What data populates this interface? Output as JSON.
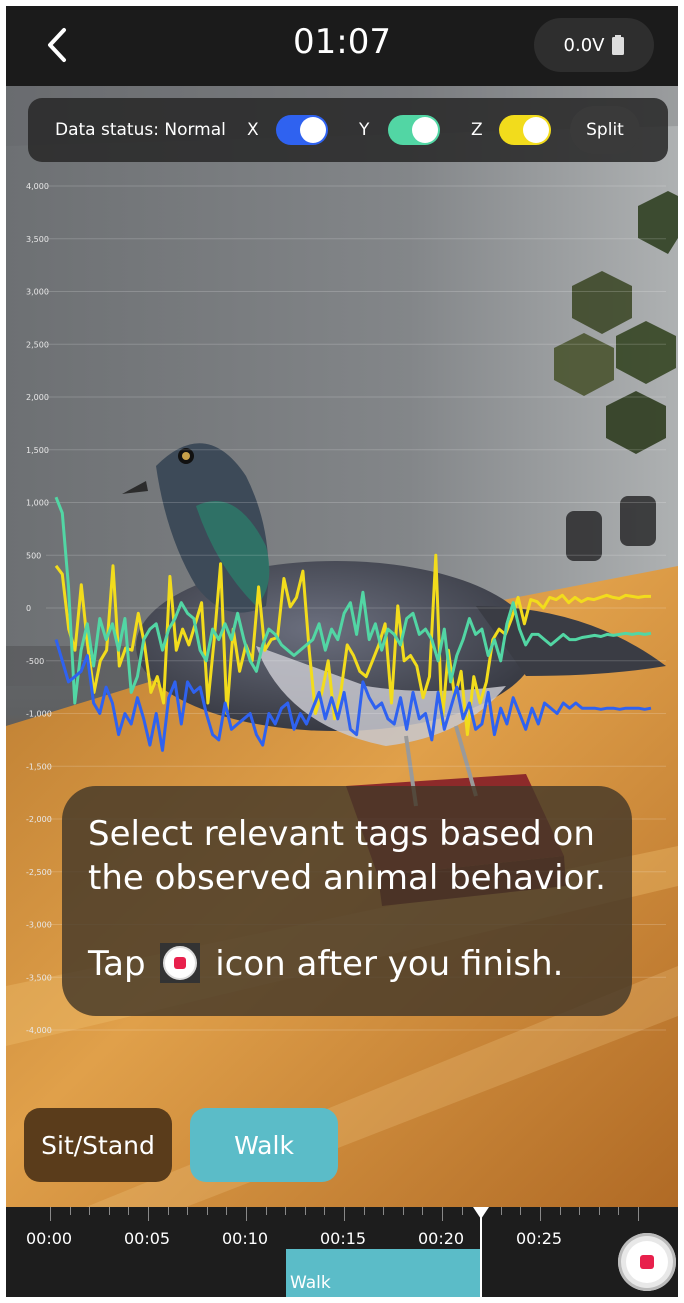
{
  "header": {
    "time": "01:07",
    "battery": "0.0V"
  },
  "status_bar": {
    "label": "Data status: Normal",
    "x_label": "X",
    "y_label": "Y",
    "z_label": "Z",
    "split_label": "Split",
    "colors": {
      "x": "#2f62f0",
      "y": "#52d6a4",
      "z": "#f2dc1c"
    }
  },
  "chart_data": {
    "type": "line",
    "y_ticks": [
      "4,000",
      "3,500",
      "3,000",
      "2,500",
      "2,000",
      "1,500",
      "1,000",
      "500",
      "0",
      "-500",
      "-1,000",
      "-1,500",
      "-2,000",
      "-2,500",
      "-3,000",
      "-3,500",
      "-4,000"
    ],
    "ylim": [
      -4000,
      4000
    ],
    "grid": true,
    "series": [
      {
        "color": "#f2dc1c",
        "values": [
          400,
          320,
          -200,
          -400,
          220,
          -350,
          -800,
          -500,
          -400,
          400,
          -550,
          -380,
          -400,
          -50,
          -350,
          -800,
          -650,
          -900,
          300,
          -400,
          -200,
          -350,
          -150,
          50,
          -900,
          -300,
          420,
          -1000,
          -200,
          -600,
          -350,
          -500,
          200,
          -400,
          -300,
          -280,
          280,
          10,
          100,
          350,
          -400,
          -1000,
          -800,
          -500,
          -1050,
          -800,
          -350,
          -450,
          -600,
          -650,
          -500,
          -350,
          -150,
          -900,
          20,
          -500,
          -450,
          -550,
          -850,
          -650,
          500,
          -1100,
          -400,
          -850,
          -600,
          -1200,
          -650,
          -900,
          -700,
          -300,
          -200,
          -250,
          -100,
          100,
          -150,
          80,
          60,
          0,
          100,
          80,
          120,
          50,
          100,
          60,
          90,
          80,
          100,
          120,
          100,
          90,
          120,
          110,
          100,
          110,
          110
        ]
      },
      {
        "color": "#52d6a4",
        "values": [
          1050,
          900,
          200,
          -900,
          -400,
          -150,
          -550,
          -100,
          -300,
          -150,
          -400,
          -100,
          -800,
          -650,
          -300,
          -200,
          -150,
          -400,
          -200,
          -100,
          50,
          -50,
          -100,
          -400,
          -500,
          -200,
          -300,
          -150,
          -300,
          -50,
          -300,
          -500,
          -600,
          -350,
          -200,
          -250,
          -350,
          -400,
          -450,
          -400,
          -350,
          -300,
          -150,
          -400,
          -200,
          -300,
          -50,
          50,
          -250,
          150,
          -300,
          -150,
          -400,
          -200,
          -250,
          -350,
          -100,
          -50,
          -250,
          -200,
          -300,
          -500,
          -200,
          -700,
          -450,
          -300,
          -100,
          -250,
          -200,
          -450,
          -300,
          -500,
          -150,
          50,
          -200,
          -350,
          -250,
          -250,
          -300,
          -350,
          -300,
          -250,
          -300,
          -300,
          -280,
          -270,
          -260,
          -270,
          -250,
          -260,
          -250,
          -240,
          -250,
          -240,
          -250,
          -240
        ]
      },
      {
        "color": "#2f62f0",
        "values": [
          -300,
          -500,
          -700,
          -650,
          -600,
          -450,
          -900,
          -1000,
          -750,
          -900,
          -1200,
          -1000,
          -1100,
          -850,
          -1050,
          -1300,
          -1000,
          -1350,
          -850,
          -700,
          -1100,
          -700,
          -800,
          -750,
          -1000,
          -1200,
          -1250,
          -900,
          -1150,
          -1100,
          -1050,
          -1000,
          -1200,
          -1300,
          -1000,
          -1100,
          -950,
          -900,
          -1150,
          -1000,
          -1100,
          -950,
          -800,
          -1050,
          -850,
          -1050,
          -800,
          -1150,
          -1200,
          -700,
          -850,
          -950,
          -900,
          -1050,
          -1100,
          -850,
          -1150,
          -800,
          -1050,
          -1000,
          -1250,
          -800,
          -1150,
          -950,
          -750,
          -1050,
          -900,
          -1150,
          -1100,
          -800,
          -1200,
          -950,
          -1100,
          -850,
          -1000,
          -1150,
          -950,
          -1100,
          -900,
          -950,
          -1000,
          -900,
          -950,
          -900,
          -950,
          -950,
          -950,
          -960,
          -950,
          -950,
          -960,
          -950,
          -950,
          -950,
          -960,
          -950
        ]
      }
    ]
  },
  "hint": {
    "line1": "Select relevant tags based on",
    "line2": "the observed animal behavior.",
    "line3_pre": "Tap",
    "line3_post": "icon after you finish."
  },
  "tags": {
    "sit_stand": "Sit/Stand",
    "walk": "Walk"
  },
  "timeline": {
    "labels": [
      "00:00",
      "00:05",
      "00:10",
      "00:15",
      "00:20",
      "00:25"
    ],
    "segment_label": "Walk"
  }
}
